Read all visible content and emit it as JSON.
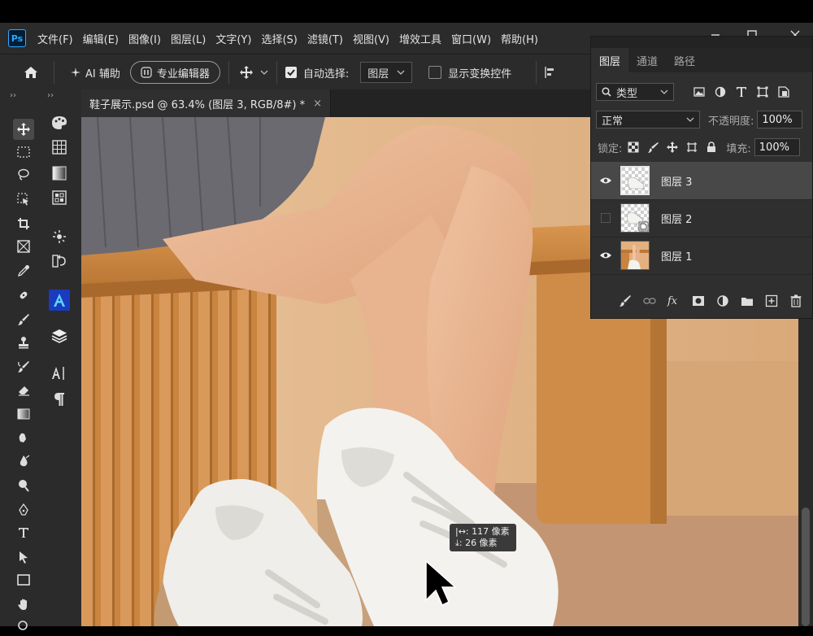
{
  "app": {
    "logo": "Ps"
  },
  "menu": [
    "文件(F)",
    "编辑(E)",
    "图像(I)",
    "图层(L)",
    "文字(Y)",
    "选择(S)",
    "滤镜(T)",
    "视图(V)",
    "增效工具",
    "窗口(W)",
    "帮助(H)"
  ],
  "options": {
    "ai_assist": "AI 辅助",
    "pro_editor": "专业编辑器",
    "auto_select_label": "自动选择:",
    "auto_select_checked": true,
    "auto_select_value": "图层",
    "show_transform_label": "显示变换控件",
    "show_transform_checked": false
  },
  "document": {
    "tab_title": "鞋子展示.psd @ 63.4% (图层 3, RGB/8#) *",
    "close_glyph": "×"
  },
  "measure": {
    "dx_label": "|↔: 117 像素",
    "dy_label": "⤓:  26 像素"
  },
  "layers_panel": {
    "tabs": [
      "图层",
      "通道",
      "路径"
    ],
    "active_tab": "图层",
    "filter_type": "类型",
    "blend_mode": "正常",
    "opacity_label": "不透明度:",
    "opacity_value": "100%",
    "lock_label": "锁定:",
    "fill_label": "填充:",
    "fill_value": "100%",
    "layers": [
      {
        "name": "图层 3",
        "visible": true,
        "selected": true,
        "thumb": "transparent-shoe"
      },
      {
        "name": "图层 2",
        "visible": false,
        "selected": false,
        "thumb": "smart-object-shoe"
      },
      {
        "name": "图层 1",
        "visible": true,
        "selected": false,
        "thumb": "photo"
      }
    ]
  },
  "colors": {
    "panel_bg": "#2f2f2f",
    "toolbar_bg": "#2b2b2b",
    "selected_layer": "#484848",
    "wood": "#c98a4b",
    "skin": "#e7b48f",
    "skirt": "#6b6a70"
  }
}
